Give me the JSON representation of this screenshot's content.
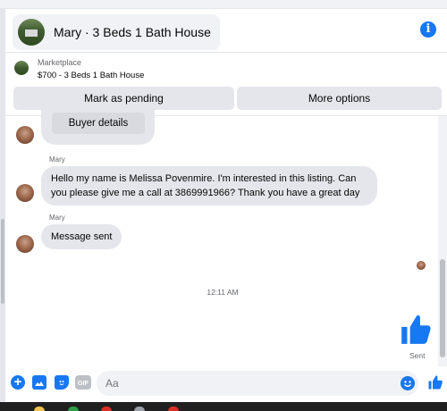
{
  "header": {
    "title": "Mary · 3 Beds 1 Bath House",
    "info_icon": "info-icon"
  },
  "marketplace": {
    "label": "Marketplace",
    "listing": "$700 - 3 Beds 1 Bath House",
    "mark_pending_label": "Mark as pending",
    "more_options_label": "More options"
  },
  "chat": {
    "buyer_details_label": "Buyer details",
    "messages": [
      {
        "sender": "Mary",
        "text": "Hello my name is Melissa Povenmire. I'm interested in this listing. Can you please give me a call at 3869991966? Thank you have a great day"
      },
      {
        "sender": "Mary",
        "text": "Message sent"
      }
    ],
    "timestamp": "12:11 AM",
    "sent_label": "Sent"
  },
  "composer": {
    "placeholder": "Aa",
    "gif_label": "GIF"
  },
  "colors": {
    "accent": "#1877f2",
    "bubble": "#e4e6eb",
    "muted_text": "#65676b"
  }
}
